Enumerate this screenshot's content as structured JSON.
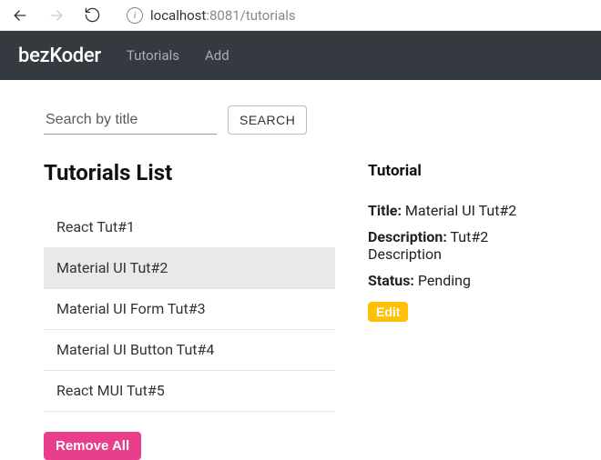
{
  "browser": {
    "url_host": "localhost",
    "url_rest": ":8081/tutorials"
  },
  "navbar": {
    "brand": "bezKoder",
    "links": [
      {
        "label": "Tutorials"
      },
      {
        "label": "Add"
      }
    ]
  },
  "search": {
    "placeholder": "Search by title",
    "button_label": "SEARCH"
  },
  "list": {
    "heading": "Tutorials List",
    "items": [
      {
        "title": "React Tut#1"
      },
      {
        "title": "Material UI Tut#2"
      },
      {
        "title": "Material UI Form Tut#3"
      },
      {
        "title": "Material UI Button Tut#4"
      },
      {
        "title": "React MUI Tut#5"
      }
    ],
    "selected_index": 1,
    "remove_all_label": "Remove All"
  },
  "detail": {
    "heading": "Tutorial",
    "labels": {
      "title": "Title:",
      "description": "Description:",
      "status": "Status:"
    },
    "values": {
      "title": "Material UI Tut#2",
      "description": "Tut#2 Description",
      "status": "Pending"
    },
    "edit_label": "Edit"
  }
}
